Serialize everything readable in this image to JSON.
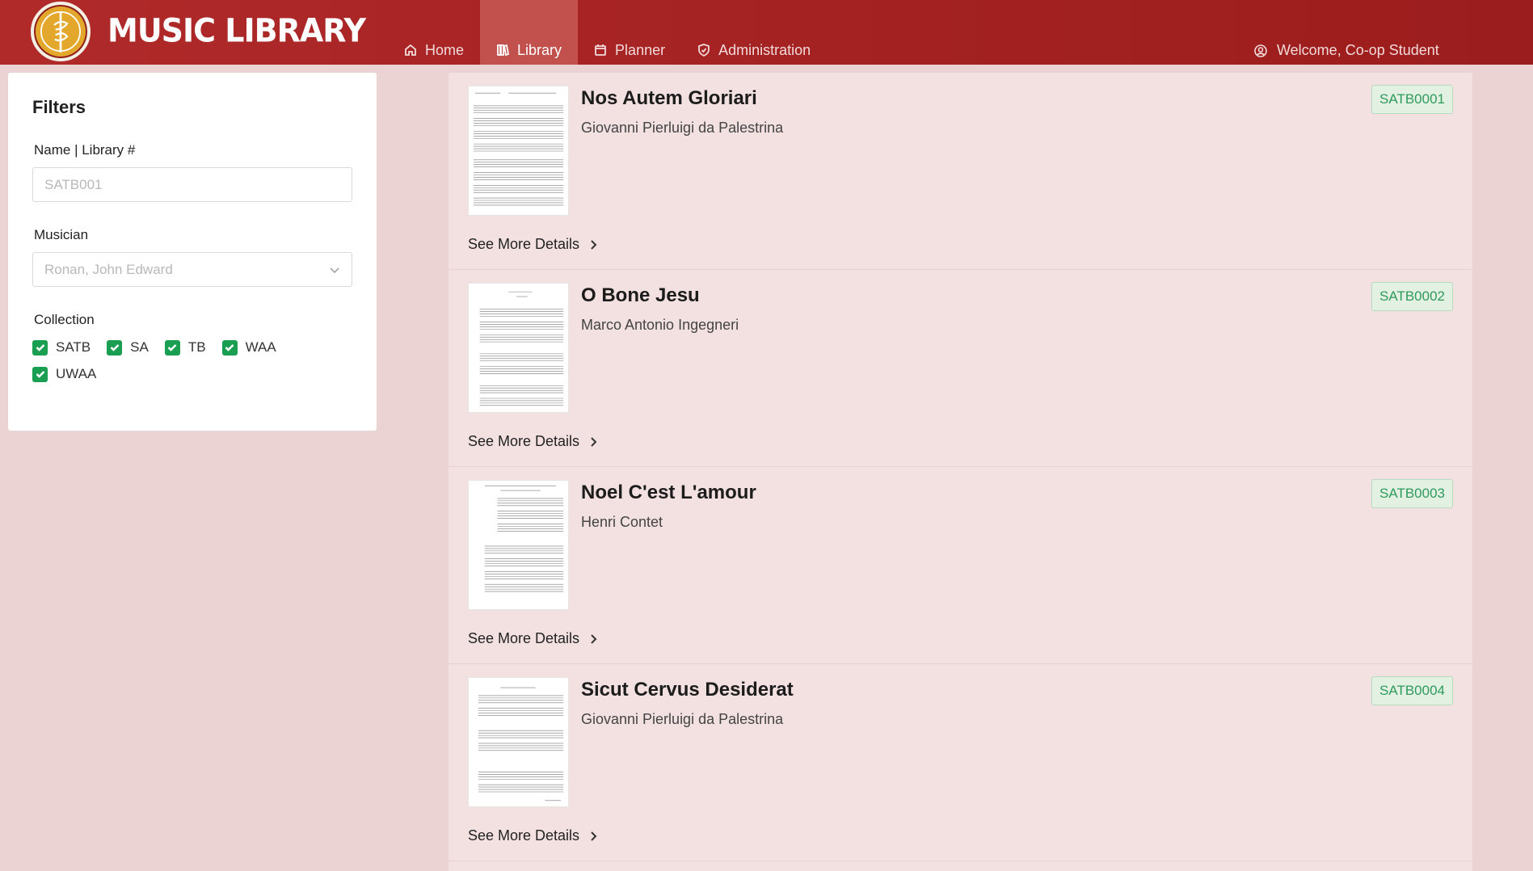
{
  "app": {
    "brand": "MUSIC LIBRARY",
    "accent_color": "#a32121",
    "logo_icon": "staff-music-icon"
  },
  "nav": {
    "items": [
      {
        "label": "Home",
        "icon": "home-icon",
        "active": false
      },
      {
        "label": "Library",
        "icon": "library-icon",
        "active": true
      },
      {
        "label": "Planner",
        "icon": "calendar-icon",
        "active": false
      },
      {
        "label": "Administration",
        "icon": "shield-icon",
        "active": false
      }
    ],
    "welcome": "Welcome, Co-op Student"
  },
  "filters": {
    "title": "Filters",
    "name_label": "Name | Library #",
    "name_placeholder": "SATB001",
    "musician_label": "Musician",
    "musician_placeholder": "Ronan, John Edward",
    "collection_label": "Collection",
    "collections": [
      {
        "label": "SATB",
        "checked": true
      },
      {
        "label": "SA",
        "checked": true
      },
      {
        "label": "TB",
        "checked": true
      },
      {
        "label": "WAA",
        "checked": true
      },
      {
        "label": "UWAA",
        "checked": true
      }
    ]
  },
  "results": [
    {
      "title": "Nos Autem Gloriari",
      "composer": "Giovanni Pierluigi da Palestrina",
      "id": "SATB0001",
      "details": "See More Details"
    },
    {
      "title": "O Bone Jesu",
      "composer": "Marco Antonio Ingegneri",
      "id": "SATB0002",
      "details": "See More Details"
    },
    {
      "title": "Noel C'est L'amour",
      "composer": "Henri Contet",
      "id": "SATB0003",
      "details": "See More Details"
    },
    {
      "title": "Sicut Cervus Desiderat",
      "composer": "Giovanni Pierluigi da Palestrina",
      "id": "SATB0004",
      "details": "See More Details"
    }
  ]
}
